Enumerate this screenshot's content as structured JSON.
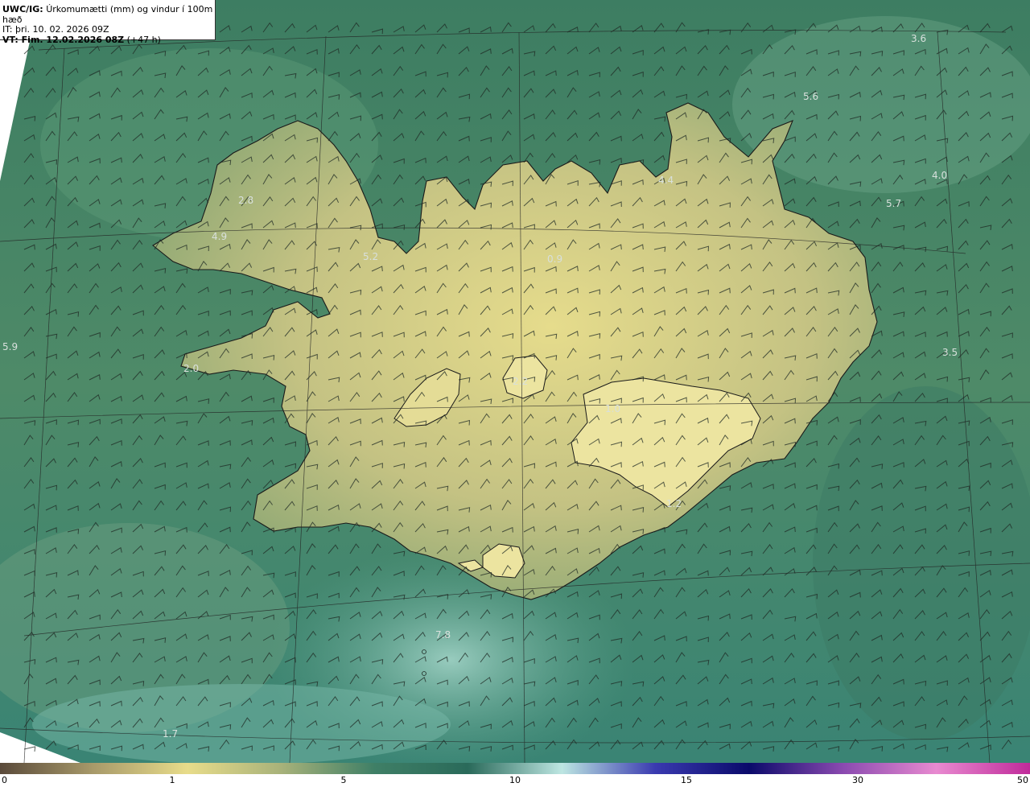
{
  "header": {
    "product_code": "UWC/IG:",
    "product_title": "Úrkomumætti (mm) og vindur í 100m hæð",
    "init_prefix": "IT:",
    "init_time": "þri. 10. 02. 2026 09Z",
    "valid_prefix": "VT:",
    "valid_time": "Fim. 12.02.2026 08Z",
    "lead_time": "(+47 h)"
  },
  "map": {
    "value_labels": [
      "3.6",
      "5.6",
      "4.4",
      "4.0",
      "5.7",
      "2.8",
      "4.9",
      "5.2",
      "5.9",
      "3.5",
      "2.0",
      "1.0",
      "2.2",
      "7.8",
      "1.7",
      "0.9",
      "1.2"
    ],
    "colors": {
      "ocean_dark": "#2e6f5a",
      "ocean_mid": "#4a8a68",
      "land_light": "#e6dc8c",
      "land_mid": "#a8b27a",
      "coast": "#1a1a1a",
      "barb": "#1f2a24"
    }
  },
  "colorbar": {
    "ticks": [
      "0",
      "1",
      "5",
      "10",
      "15",
      "30",
      "50"
    ],
    "stops": [
      "#5a4a3a",
      "#a89a6a",
      "#e8dc8a",
      "#a8b27a",
      "#3f7f66",
      "#2a6a5a",
      "#bde6e2",
      "#3a3ab0",
      "#0a0a6a",
      "#8a4ab0",
      "#e88ad0",
      "#c02a9a"
    ]
  }
}
